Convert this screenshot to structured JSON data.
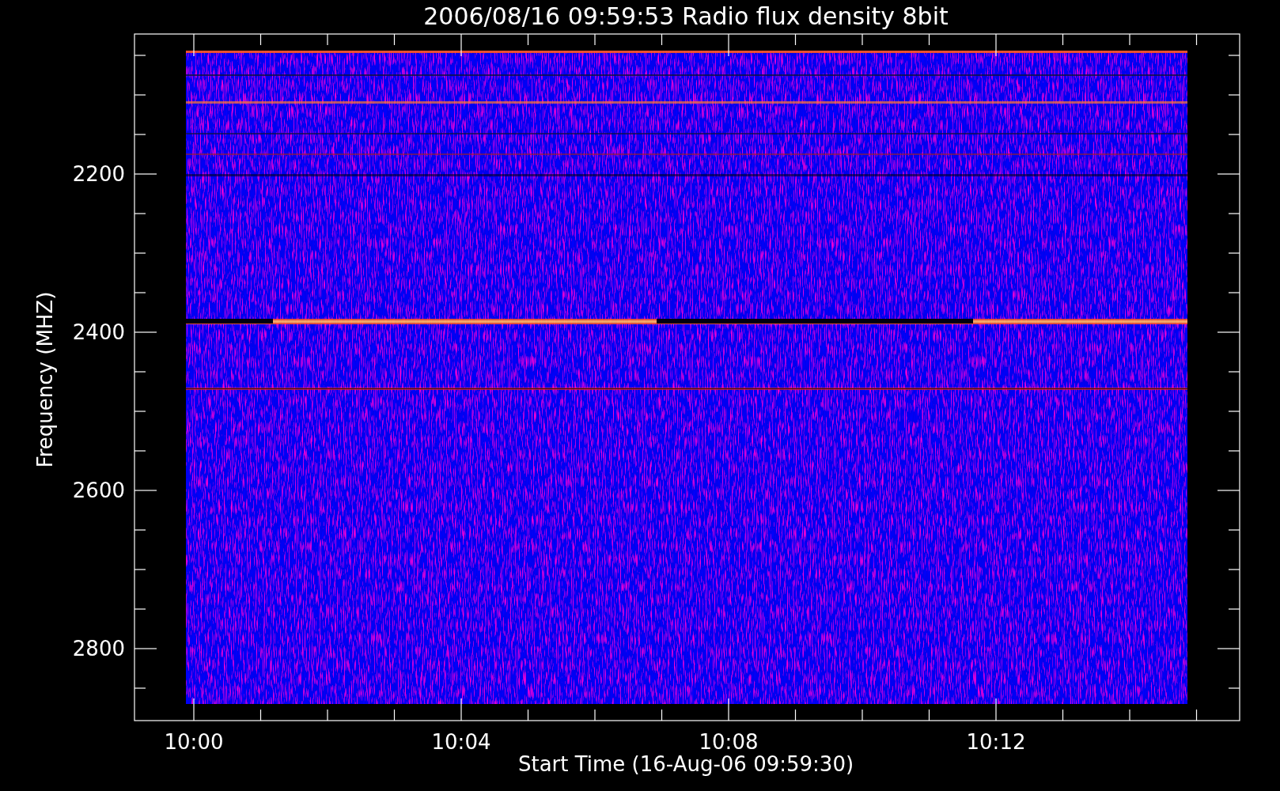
{
  "plot": {
    "title": "2006/08/16 09:59:53 Radio flux density 8bit",
    "x_axis": {
      "label": "Start Time (16-Aug-06 09:59:30)",
      "ticks": [
        "10:00",
        "10:04",
        "10:08",
        "10:12"
      ]
    },
    "y_axis": {
      "label": "Frequency (MHZ)",
      "ticks": [
        "2200",
        "2400",
        "2600",
        "2800"
      ]
    }
  }
}
